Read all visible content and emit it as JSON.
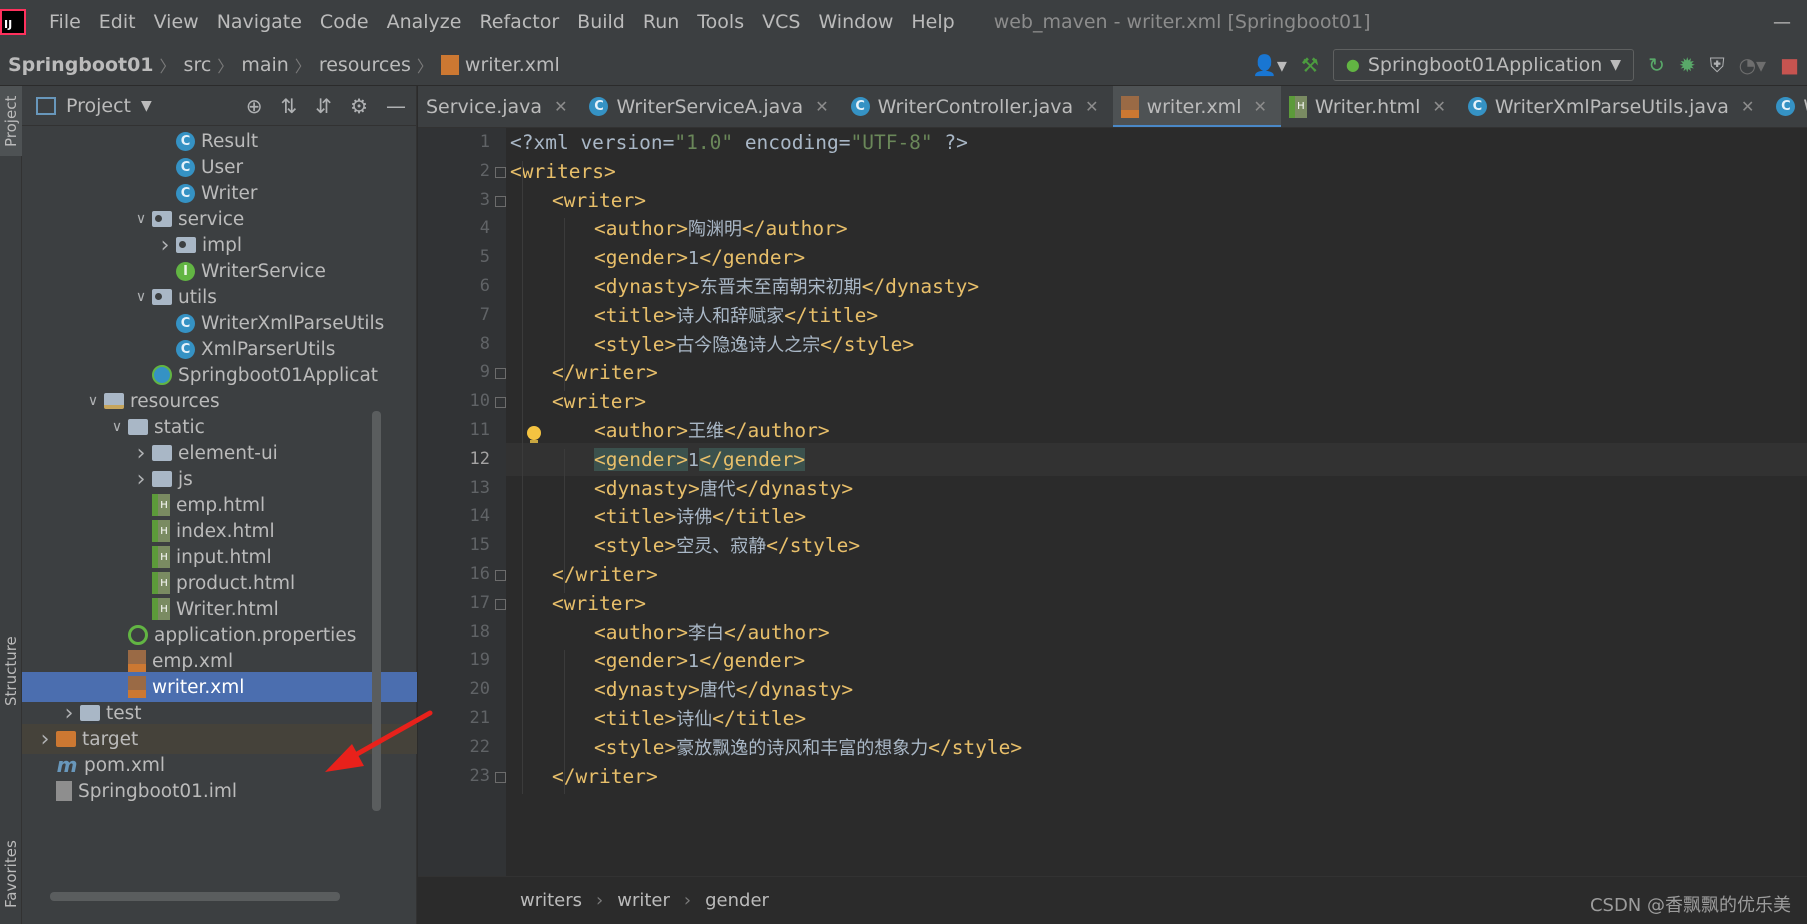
{
  "menubar": {
    "items": [
      "File",
      "Edit",
      "View",
      "Navigate",
      "Code",
      "Analyze",
      "Refactor",
      "Build",
      "Run",
      "Tools",
      "VCS",
      "Window",
      "Help"
    ],
    "window_title": "web_maven - writer.xml [Springboot01]"
  },
  "navbar": {
    "crumbs": [
      "Springboot01",
      "src",
      "main",
      "resources",
      "writer.xml"
    ],
    "run_config": "Springboot01Application"
  },
  "left_stripe": {
    "project": "Project",
    "structure": "Structure",
    "favorites": "Favorites"
  },
  "project_panel": {
    "title": "Project",
    "tree": [
      {
        "label": "Result",
        "icon": "class-icon",
        "indent": 7,
        "arrow": ""
      },
      {
        "label": "User",
        "icon": "class-icon",
        "indent": 7,
        "arrow": ""
      },
      {
        "label": "Writer",
        "icon": "class-icon",
        "indent": 7,
        "arrow": ""
      },
      {
        "label": "service",
        "icon": "package-icon",
        "indent": 6,
        "arrow": "v"
      },
      {
        "label": "impl",
        "icon": "package-icon",
        "indent": 7,
        "arrow": ">"
      },
      {
        "label": "WriterService",
        "icon": "interface-icon",
        "indent": 7,
        "arrow": ""
      },
      {
        "label": "utils",
        "icon": "package-icon",
        "indent": 6,
        "arrow": "v"
      },
      {
        "label": "WriterXmlParseUtils",
        "icon": "class-icon",
        "indent": 7,
        "arrow": ""
      },
      {
        "label": "XmlParserUtils",
        "icon": "class-icon",
        "indent": 7,
        "arrow": ""
      },
      {
        "label": "Springboot01Applicat",
        "icon": "spring-app-icon",
        "indent": 6,
        "arrow": ""
      },
      {
        "label": "resources",
        "icon": "resources-folder-icon",
        "indent": 4,
        "arrow": "v"
      },
      {
        "label": "static",
        "icon": "folder-icon",
        "indent": 5,
        "arrow": "v"
      },
      {
        "label": "element-ui",
        "icon": "folder-icon",
        "indent": 6,
        "arrow": ">"
      },
      {
        "label": "js",
        "icon": "folder-icon",
        "indent": 6,
        "arrow": ">"
      },
      {
        "label": "emp.html",
        "icon": "html-file-icon",
        "indent": 6,
        "arrow": ""
      },
      {
        "label": "index.html",
        "icon": "html-file-icon",
        "indent": 6,
        "arrow": ""
      },
      {
        "label": "input.html",
        "icon": "html-file-icon",
        "indent": 6,
        "arrow": ""
      },
      {
        "label": "product.html",
        "icon": "html-file-icon",
        "indent": 6,
        "arrow": ""
      },
      {
        "label": "Writer.html",
        "icon": "html-file-icon",
        "indent": 6,
        "arrow": ""
      },
      {
        "label": "application.properties",
        "icon": "spring-properties-icon",
        "indent": 5,
        "arrow": ""
      },
      {
        "label": "emp.xml",
        "icon": "xml-file-icon",
        "indent": 5,
        "arrow": ""
      },
      {
        "label": "writer.xml",
        "icon": "xml-file-icon",
        "indent": 5,
        "arrow": "",
        "selected": true
      },
      {
        "label": "test",
        "icon": "folder-icon",
        "indent": 3,
        "arrow": ">"
      },
      {
        "label": "target",
        "icon": "target-folder-icon",
        "indent": 2,
        "arrow": ">"
      },
      {
        "label": "pom.xml",
        "icon": "maven-icon",
        "indent": 2,
        "arrow": ""
      },
      {
        "label": "Springboot01.iml",
        "icon": "iml-file-icon",
        "indent": 2,
        "arrow": ""
      }
    ]
  },
  "tabs": [
    {
      "label": "Service.java",
      "icon": "none"
    },
    {
      "label": "WriterServiceA.java",
      "icon": "class-icon"
    },
    {
      "label": "WriterController.java",
      "icon": "class-icon"
    },
    {
      "label": "writer.xml",
      "icon": "xml-file-icon",
      "active": true
    },
    {
      "label": "Writer.html",
      "icon": "html-file-icon"
    },
    {
      "label": "WriterXmlParseUtils.java",
      "icon": "class-icon"
    },
    {
      "label": "Writer.java",
      "icon": "class-icon"
    }
  ],
  "editor": {
    "current_line": 12,
    "lines": [
      {
        "n": "1",
        "indent": 0,
        "kind": "pi",
        "text": "<?xml version=\"1.0\" encoding=\"UTF-8\" ?>"
      },
      {
        "n": "2",
        "indent": 0,
        "kind": "open",
        "tag": "writers"
      },
      {
        "n": "3",
        "indent": 1,
        "kind": "open",
        "tag": "writer"
      },
      {
        "n": "4",
        "indent": 2,
        "kind": "elem",
        "tag": "author",
        "value": "陶渊明"
      },
      {
        "n": "5",
        "indent": 2,
        "kind": "elem",
        "tag": "gender",
        "value": "1"
      },
      {
        "n": "6",
        "indent": 2,
        "kind": "elem",
        "tag": "dynasty",
        "value": "东晋末至南朝宋初期"
      },
      {
        "n": "7",
        "indent": 2,
        "kind": "elem",
        "tag": "title",
        "value": "诗人和辞赋家"
      },
      {
        "n": "8",
        "indent": 2,
        "kind": "elem",
        "tag": "style",
        "value": "古今隐逸诗人之宗"
      },
      {
        "n": "9",
        "indent": 1,
        "kind": "close",
        "tag": "writer"
      },
      {
        "n": "10",
        "indent": 1,
        "kind": "open",
        "tag": "writer"
      },
      {
        "n": "11",
        "indent": 2,
        "kind": "elem",
        "tag": "author",
        "value": "王维"
      },
      {
        "n": "12",
        "indent": 2,
        "kind": "elem",
        "tag": "gender",
        "value": "1",
        "highlight": true
      },
      {
        "n": "13",
        "indent": 2,
        "kind": "elem",
        "tag": "dynasty",
        "value": "唐代"
      },
      {
        "n": "14",
        "indent": 2,
        "kind": "elem",
        "tag": "title",
        "value": "诗佛"
      },
      {
        "n": "15",
        "indent": 2,
        "kind": "elem",
        "tag": "style",
        "value": "空灵、寂静"
      },
      {
        "n": "16",
        "indent": 1,
        "kind": "close",
        "tag": "writer"
      },
      {
        "n": "17",
        "indent": 1,
        "kind": "open",
        "tag": "writer"
      },
      {
        "n": "18",
        "indent": 2,
        "kind": "elem",
        "tag": "author",
        "value": "李白"
      },
      {
        "n": "19",
        "indent": 2,
        "kind": "elem",
        "tag": "gender",
        "value": "1"
      },
      {
        "n": "20",
        "indent": 2,
        "kind": "elem",
        "tag": "dynasty",
        "value": "唐代"
      },
      {
        "n": "21",
        "indent": 2,
        "kind": "elem",
        "tag": "title",
        "value": "诗仙"
      },
      {
        "n": "22",
        "indent": 2,
        "kind": "elem",
        "tag": "style",
        "value": "豪放飘逸的诗风和丰富的想象力"
      },
      {
        "n": "23",
        "indent": 1,
        "kind": "close",
        "tag": "writer"
      }
    ]
  },
  "breadcrumb": [
    "writers",
    "writer",
    "gender"
  ],
  "watermark": "CSDN @香飘飘的优乐美",
  "colors": {
    "selection": "#4b6eaf",
    "tag": "#e8bf6a",
    "attr_value": "#6a8759",
    "arrow": "#e8211b"
  }
}
